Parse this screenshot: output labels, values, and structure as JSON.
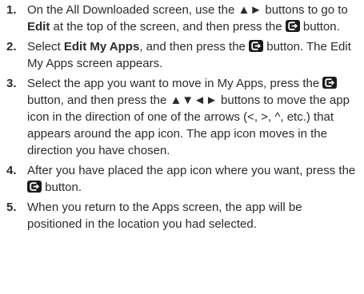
{
  "steps": [
    {
      "number": "1.",
      "parts": [
        {
          "t": "text",
          "v": "On the All Downloaded screen, use the ▲► buttons to go to "
        },
        {
          "t": "bold",
          "v": "Edit"
        },
        {
          "t": "text",
          "v": " at the top of the screen, and then press the "
        },
        {
          "t": "icon",
          "v": "enter-icon"
        },
        {
          "t": "text",
          "v": " button."
        }
      ]
    },
    {
      "number": "2.",
      "parts": [
        {
          "t": "text",
          "v": "Select "
        },
        {
          "t": "bold",
          "v": "Edit My Apps"
        },
        {
          "t": "text",
          "v": ", and then press the "
        },
        {
          "t": "icon",
          "v": "enter-icon"
        },
        {
          "t": "text",
          "v": " button. The Edit My Apps screen appears."
        }
      ]
    },
    {
      "number": "3.",
      "parts": [
        {
          "t": "text",
          "v": "Select the app you want to move in My Apps, press the "
        },
        {
          "t": "icon",
          "v": "enter-icon"
        },
        {
          "t": "text",
          "v": " button, and then press the ▲▼◄► buttons to move the app icon in the direction of one of the arrows (<, >, ^, etc.) that appears around the app icon. The app icon moves in the direction you have chosen."
        }
      ]
    },
    {
      "number": "4.",
      "parts": [
        {
          "t": "text",
          "v": "After you have placed the app icon where you want, press the "
        },
        {
          "t": "icon",
          "v": "enter-icon"
        },
        {
          "t": "text",
          "v": " button."
        }
      ]
    },
    {
      "number": "5.",
      "parts": [
        {
          "t": "text",
          "v": "When you return to the Apps screen, the app will be positioned in the location you had selected."
        }
      ]
    }
  ]
}
